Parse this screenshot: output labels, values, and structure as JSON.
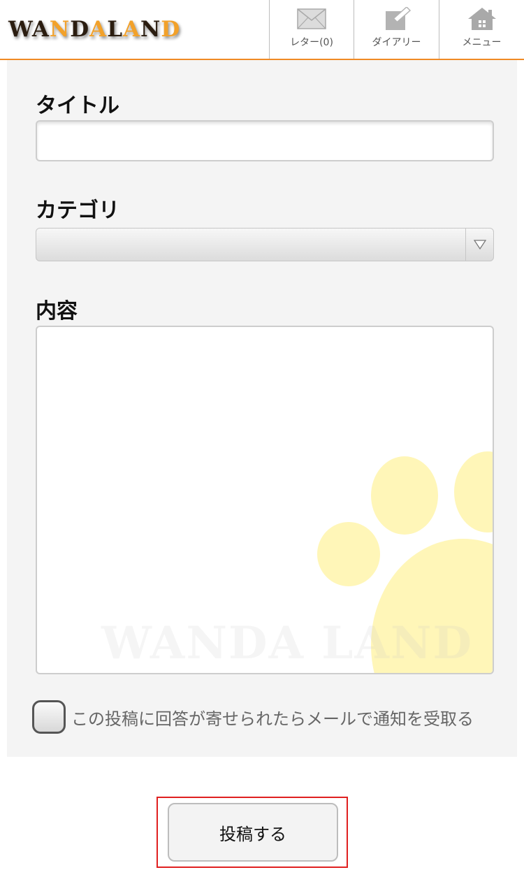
{
  "header": {
    "logo_parts": [
      {
        "text": "WA",
        "tone": "dark"
      },
      {
        "text": "N",
        "tone": "orange"
      },
      {
        "text": "D",
        "tone": "dark"
      },
      {
        "text": "A",
        "tone": "orange"
      },
      {
        "text": "L",
        "tone": "dark"
      },
      {
        "text": "A",
        "tone": "orange"
      },
      {
        "text": "N",
        "tone": "dark"
      },
      {
        "text": "D",
        "tone": "orange"
      }
    ],
    "nav": {
      "letter": "レター(0)",
      "diary": "ダイアリー",
      "menu": "メニュー"
    },
    "icons": [
      "envelope-icon",
      "pencil-icon",
      "house-icon"
    ]
  },
  "form": {
    "title_label": "タイトル",
    "title_value": "",
    "category_label": "カテゴリ",
    "category_value": "",
    "content_label": "内容",
    "content_value": "",
    "watermark": "WANDA LAND",
    "notify_label": "この投稿に回答が寄せられたらメールで通知を受取る",
    "notify_checked": false,
    "submit_label": "投稿する"
  },
  "colors": {
    "accent": "#f08a24",
    "panel_bg": "#f4f4f4",
    "paw": "#fff6b8",
    "highlight": "#e02020"
  }
}
